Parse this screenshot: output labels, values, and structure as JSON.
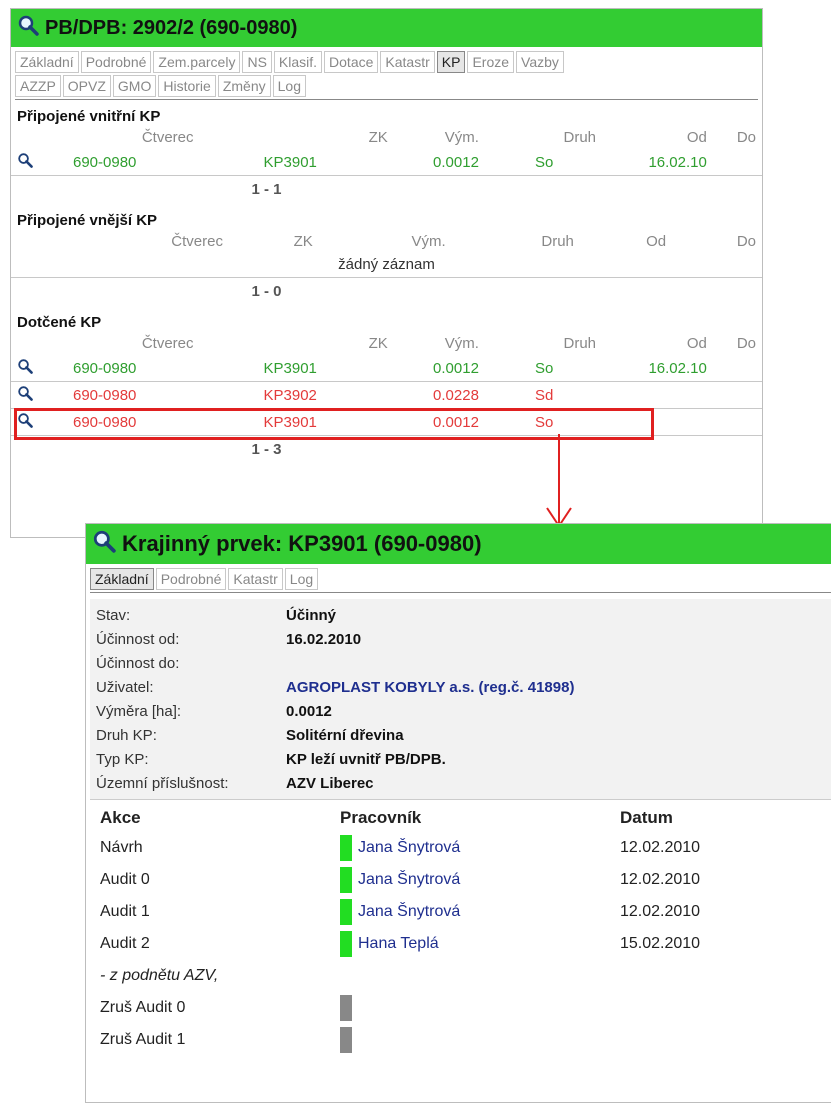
{
  "panel1": {
    "title": "PB/DPB: 2902/2 (690-0980)",
    "tabs_row1": [
      "Základní",
      "Podrobné",
      "Zem.parcely",
      "NS",
      "Klasif.",
      "Dotace",
      "Katastr",
      "KP",
      "Eroze",
      "Vazby"
    ],
    "tabs_row2": [
      "AZZP",
      "OPVZ",
      "GMO",
      "Historie",
      "Změny",
      "Log"
    ],
    "active_tab": "KP",
    "columns": [
      "Čtverec",
      "ZK",
      "Vým.",
      "Druh",
      "Od",
      "Do"
    ],
    "sections": [
      {
        "title": "Připojené vnitřní KP",
        "rows": [
          {
            "ctverec": "690-0980",
            "zk": "KP3901",
            "vym": "0.0012",
            "druh": "So",
            "od": "16.02.10",
            "do": "",
            "color": "green"
          }
        ],
        "pager": "1 - 1"
      },
      {
        "title": "Připojené vnější KP",
        "rows": [],
        "empty": "žádný záznam",
        "pager": "1 - 0"
      },
      {
        "title": "Dotčené KP",
        "rows": [
          {
            "ctverec": "690-0980",
            "zk": "KP3901",
            "vym": "0.0012",
            "druh": "So",
            "od": "16.02.10",
            "do": "",
            "color": "green"
          },
          {
            "ctverec": "690-0980",
            "zk": "KP3902",
            "vym": "0.0228",
            "druh": "Sd",
            "od": "",
            "do": "",
            "color": "red"
          },
          {
            "ctverec": "690-0980",
            "zk": "KP3901",
            "vym": "0.0012",
            "druh": "So",
            "od": "",
            "do": "",
            "color": "red"
          }
        ],
        "pager": "1 - 3"
      }
    ]
  },
  "panel2": {
    "title": "Krajinný prvek: KP3901 (690-0980)",
    "tabs": [
      "Základní",
      "Podrobné",
      "Katastr",
      "Log"
    ],
    "active_tab": "Základní",
    "fields": [
      {
        "label": "Stav:",
        "value": "Účinný"
      },
      {
        "label": "Účinnost od:",
        "value": "16.02.2010"
      },
      {
        "label": "Účinnost do:",
        "value": ""
      },
      {
        "label": "Uživatel:",
        "value": "AGROPLAST KOBYLY a.s. (reg.č. 41898)",
        "link": true
      },
      {
        "label": "Výměra [ha]:",
        "value": "0.0012"
      },
      {
        "label": "Druh KP:",
        "value": "Solitérní dřevina"
      },
      {
        "label": "Typ KP:",
        "value": "KP leží uvnitř PB/DPB."
      },
      {
        "label": "Územní příslušnost:",
        "value": "AZV Liberec"
      }
    ],
    "audit_headers": {
      "akce": "Akce",
      "pracovnik": "Pracovník",
      "datum": "Datum"
    },
    "audit_rows": [
      {
        "akce": "Návrh",
        "pracovnik": "Jana Šnytrová",
        "datum": "12.02.2010",
        "bar": "green"
      },
      {
        "akce": "Audit 0",
        "pracovnik": "Jana Šnytrová",
        "datum": "12.02.2010",
        "bar": "green"
      },
      {
        "akce": "Audit 1",
        "pracovnik": "Jana Šnytrová",
        "datum": "12.02.2010",
        "bar": "green"
      },
      {
        "akce": "Audit 2",
        "pracovnik": "Hana Teplá",
        "datum": "15.02.2010",
        "bar": "green"
      },
      {
        "akce": "- z podnětu AZV,",
        "pracovnik": "",
        "datum": "",
        "bar": "",
        "italic": true
      },
      {
        "akce": "Zruš Audit 0",
        "pracovnik": "",
        "datum": "",
        "bar": "gray"
      },
      {
        "akce": "Zruš Audit 1",
        "pracovnik": "",
        "datum": "",
        "bar": "gray"
      }
    ]
  },
  "colors": {
    "title_green": "#33cc33",
    "row_green": "#2f9e2f",
    "row_red": "#e33a3a",
    "bar_green": "#22dd22",
    "bar_gray": "#888888",
    "highlight": "#e02020"
  },
  "icons": {
    "lens": "magnifier-icon",
    "arrow": "down-arrow-icon"
  }
}
